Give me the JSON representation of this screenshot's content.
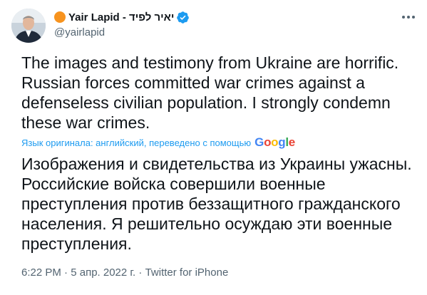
{
  "tweet": {
    "author": {
      "display_name": "Yair Lapid - יאיר לפיד",
      "handle": "@yairlapid"
    },
    "text": "The images and testimony from Ukraine are horrific. Russian forces committed war crimes against a defenseless civilian population. I strongly condemn these war crimes.",
    "translation_note": "Язык оригинала: английский, переведено с помощью",
    "translation_provider": "Google",
    "translated_text": "Изображения и свидетельства из Украины ужасны. Российские войска совершили военные преступления против беззащитного гражданского населения. Я решительно осуждаю эти военные преступления.",
    "time": "6:22 PM",
    "date": "5 апр. 2022 г.",
    "source": "Twitter for iPhone"
  },
  "colors": {
    "text": "#0f1419",
    "secondary": "#536471",
    "link": "#1d9bf0",
    "verified": "#1d9bf0",
    "org_badge": "#f7931e"
  },
  "icons": [
    "verified-badge-icon",
    "more-options-icon",
    "organization-badge-icon"
  ]
}
